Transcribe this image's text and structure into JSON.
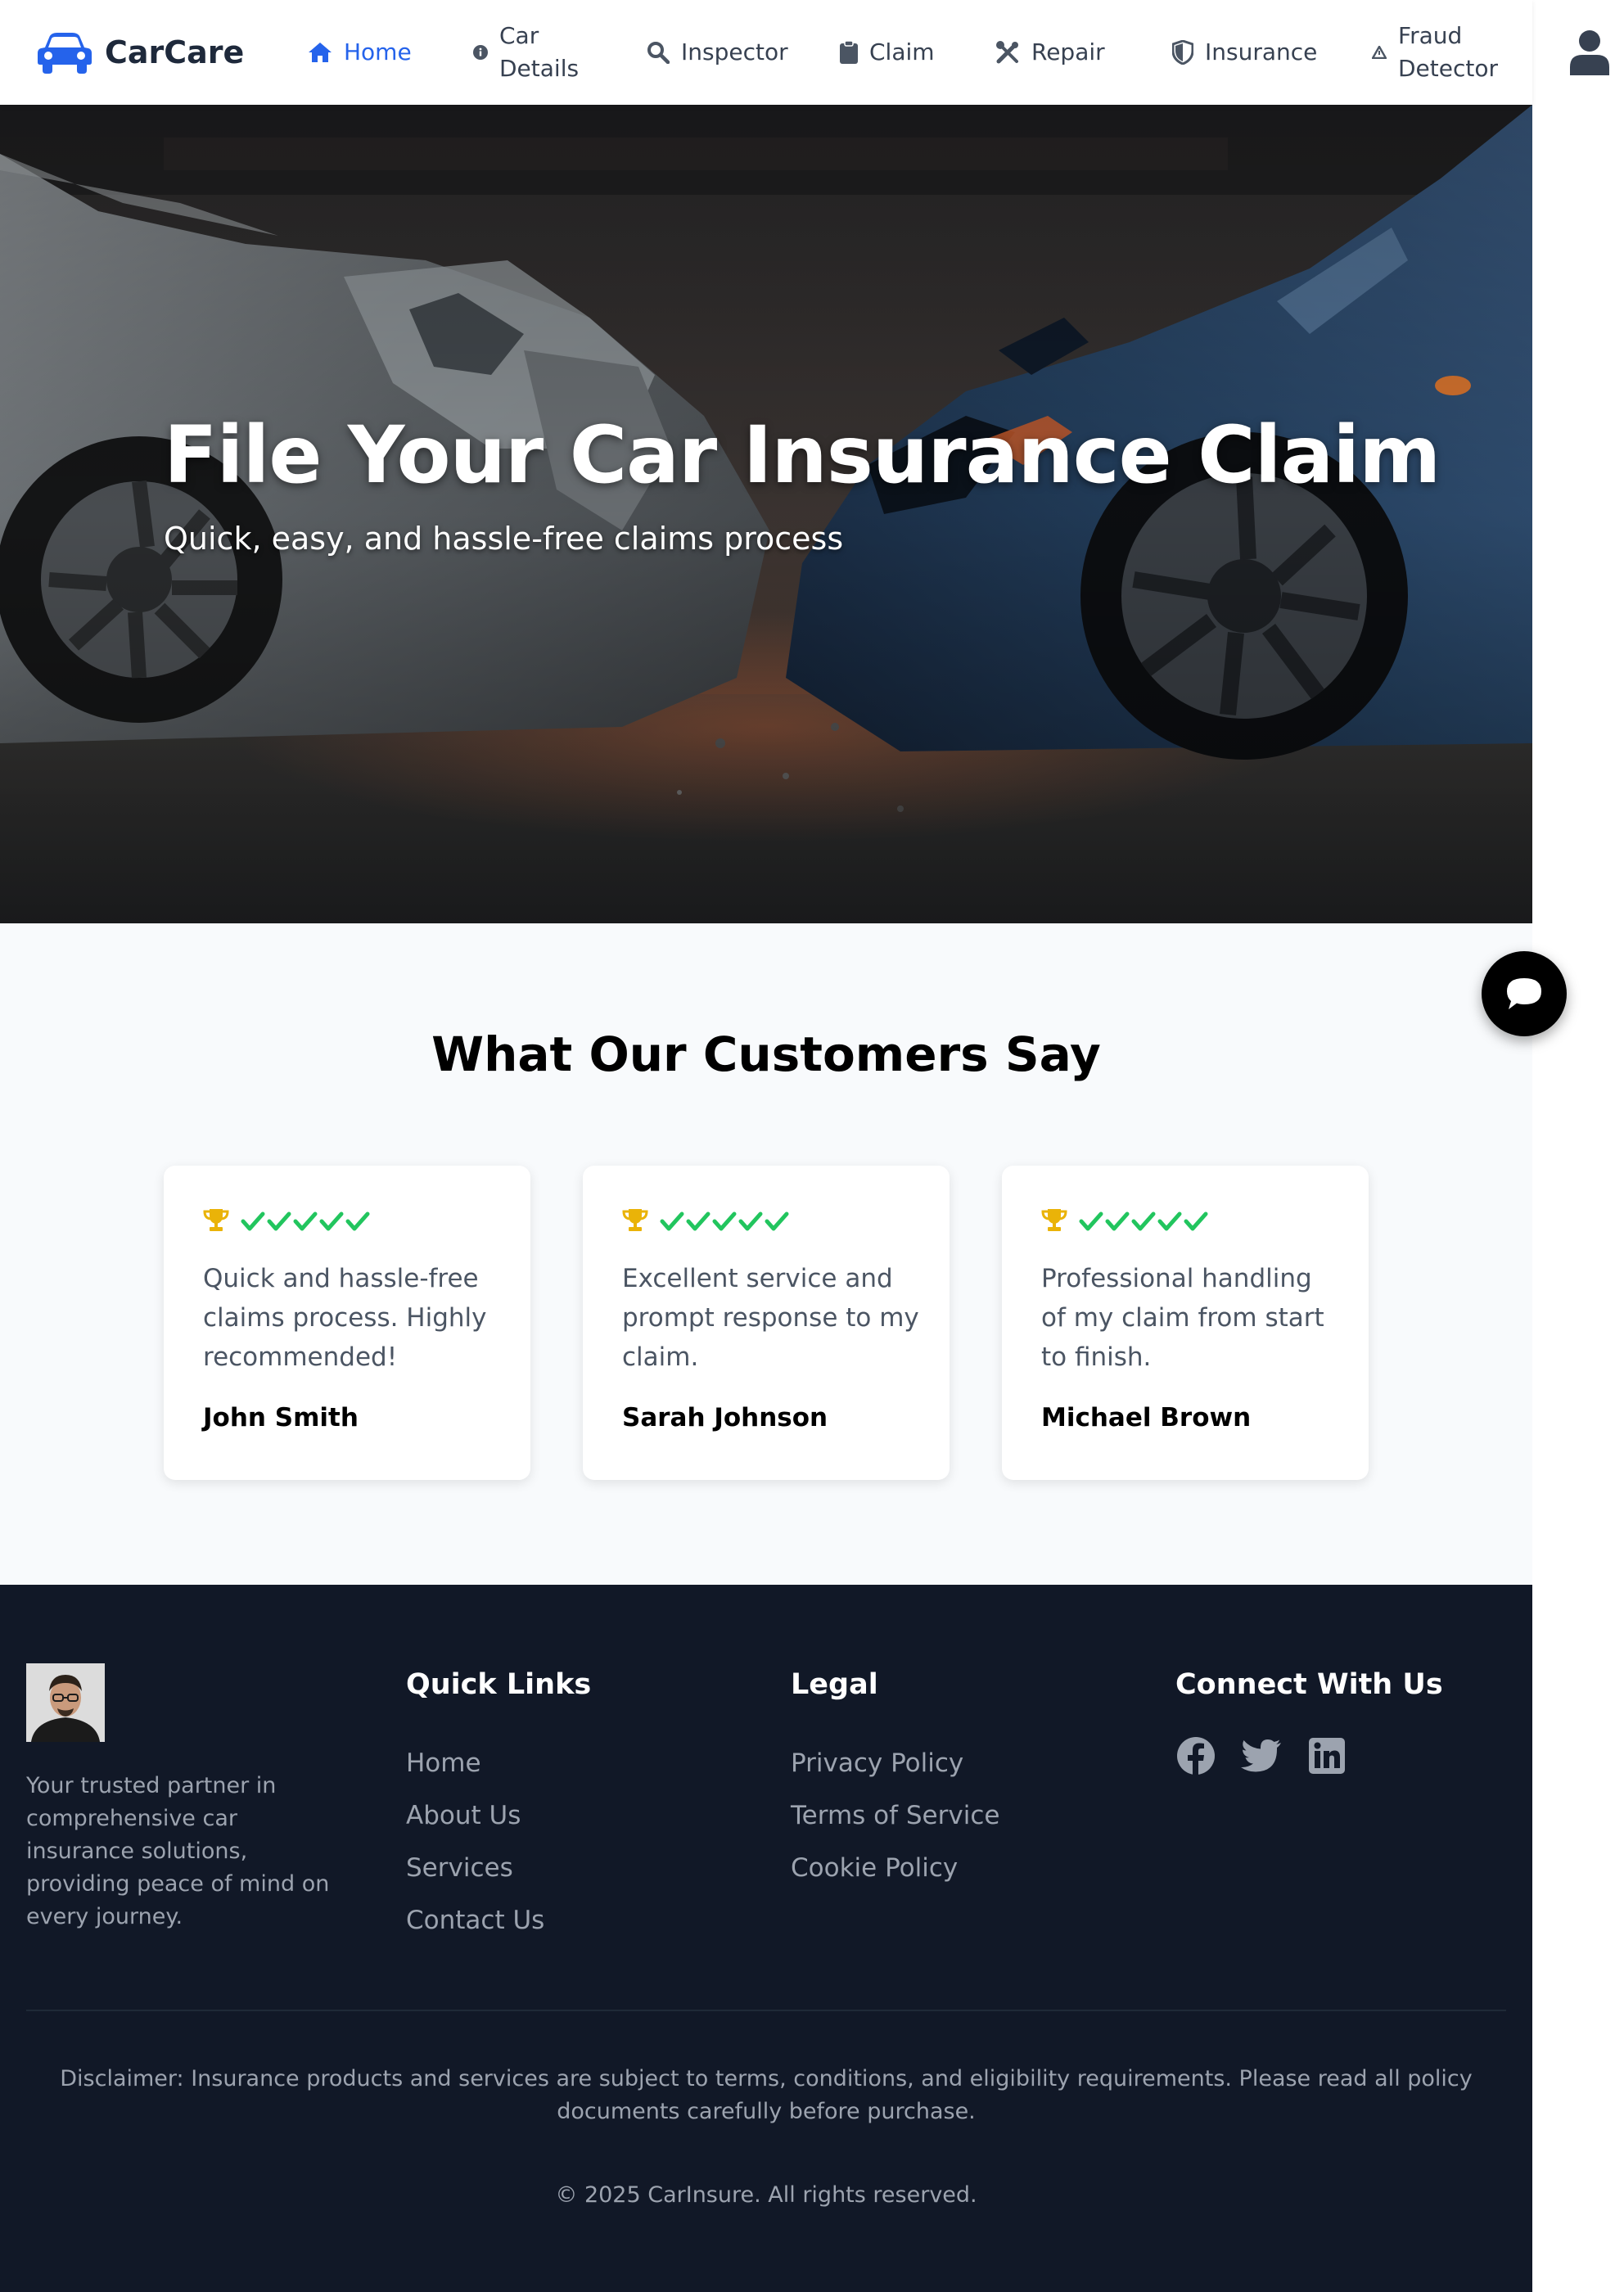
{
  "brand": {
    "name": "CarCare"
  },
  "nav": {
    "items": [
      {
        "line1": "Home",
        "line2": "",
        "icon": "home-icon",
        "active": true
      },
      {
        "line1": "Car",
        "line2": "Details",
        "icon": "info-icon",
        "active": false
      },
      {
        "line1": "Inspector",
        "line2": "",
        "icon": "search-icon",
        "active": false
      },
      {
        "line1": "Claim",
        "line2": "",
        "icon": "clipboard-icon",
        "active": false
      },
      {
        "line1": "Repair",
        "line2": "",
        "icon": "tools-icon",
        "active": false
      },
      {
        "line1": "Insurance",
        "line2": "",
        "icon": "shield-icon",
        "active": false
      },
      {
        "line1": "Fraud",
        "line2": "Detector",
        "icon": "warning-icon",
        "active": false
      }
    ],
    "user_icon": "user-icon",
    "accent_color": "#2563eb"
  },
  "hero": {
    "title": "File Your Car Insurance Claim",
    "subtitle": "Quick, easy, and hassle-free claims process"
  },
  "chat": {
    "icon": "chat-bubble-icon"
  },
  "testimonials": {
    "heading": "What Our Customers Say",
    "check_color": "#22c55e",
    "trophy_color": "#eab308",
    "items": [
      {
        "quote": "Quick and hassle-free claims process. Highly recommended!",
        "author": "John Smith",
        "rating": 5
      },
      {
        "quote": "Excellent service and prompt response to my claim.",
        "author": "Sarah Johnson",
        "rating": 5
      },
      {
        "quote": "Professional handling of my claim from start to finish.",
        "author": "Michael Brown",
        "rating": 5
      }
    ]
  },
  "footer": {
    "about": "Your trusted partner in comprehensive car insurance solutions, providing peace of mind on every journey.",
    "quick_links": {
      "title": "Quick Links",
      "links": [
        "Home",
        "About Us",
        "Services",
        "Contact Us"
      ]
    },
    "legal": {
      "title": "Legal",
      "links": [
        "Privacy Policy",
        "Terms of Service",
        "Cookie Policy"
      ]
    },
    "connect": {
      "title": "Connect With Us",
      "icons": [
        "facebook-icon",
        "twitter-icon",
        "linkedin-icon"
      ]
    },
    "disclaimer": "Disclaimer: Insurance products and services are subject to terms, conditions, and eligibility requirements. Please read all policy documents carefully before purchase.",
    "copyright": "© 2025 CarInsure. All rights reserved.",
    "background_color": "#111827"
  }
}
